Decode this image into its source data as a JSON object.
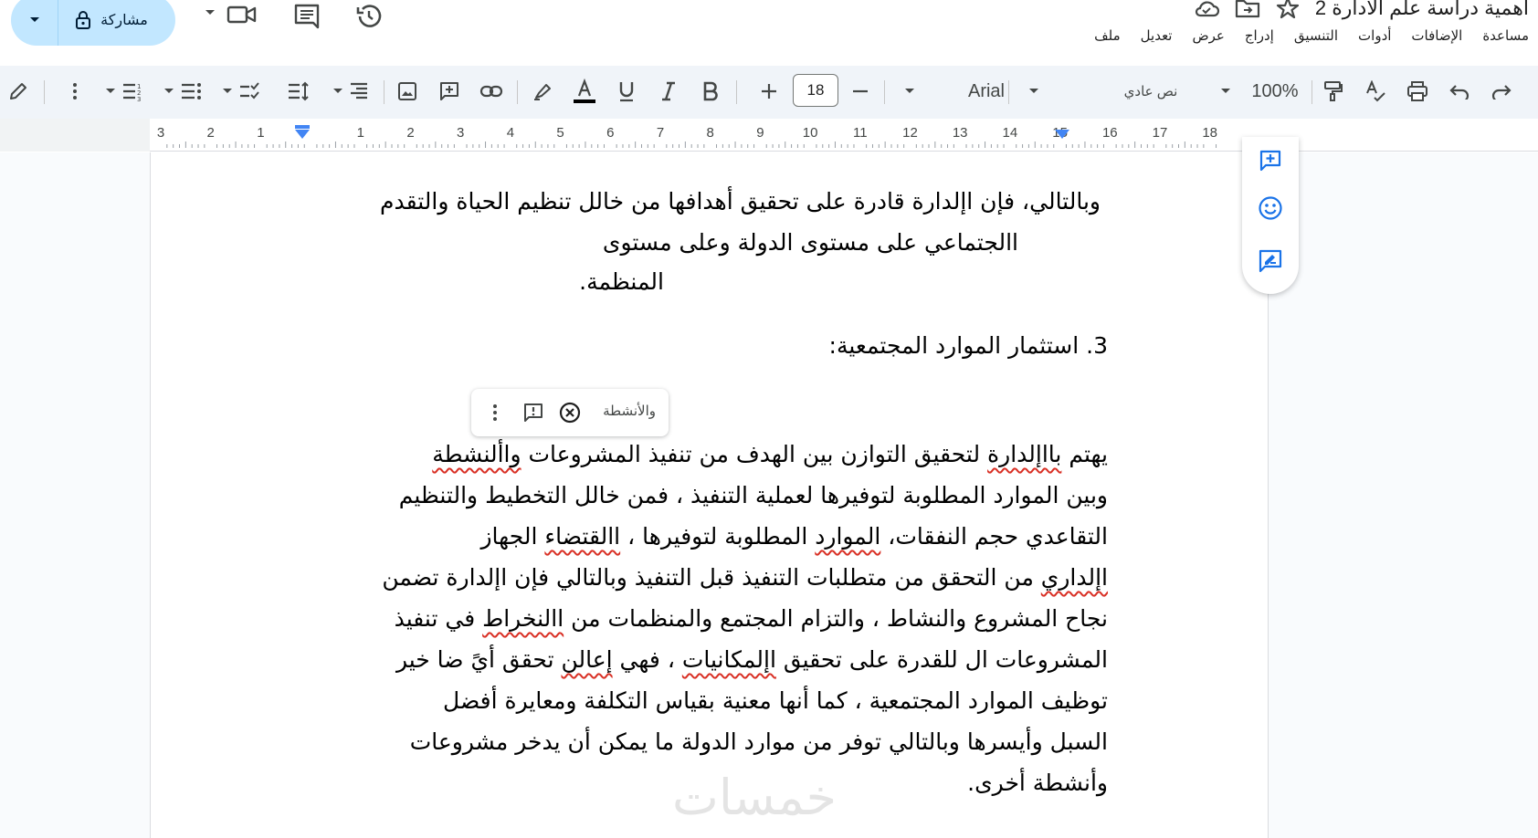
{
  "titlebar": {
    "document_title": "اهمية دراسة علم الادارة 2",
    "share_label": "مشاركة",
    "icons": [
      "lock-icon",
      "meet-video-icon",
      "comments-icon",
      "version-history-icon",
      "cloud-saved-icon",
      "move-to-folder-icon",
      "star-icon"
    ]
  },
  "menu": [
    "ملف",
    "تعديل",
    "عرض",
    "إدراج",
    "التنسيق",
    "أدوات",
    "الإضافات",
    "مساعدة"
  ],
  "toolbar": {
    "font_size": "18",
    "font_name": "Arial",
    "paragraph_style": "نص عادي",
    "zoom": "100%"
  },
  "ruler": {
    "labels": [
      "3",
      "2",
      "1",
      "",
      "1",
      "2",
      "3",
      "4",
      "5",
      "6",
      "7",
      "8",
      "9",
      "10",
      "11",
      "12",
      "13",
      "14",
      "15",
      "16",
      "17",
      "18"
    ]
  },
  "document": {
    "para1": {
      "line1": "وبالتالي، فإن اإلدارة قادرة على تحقيق أهدافها من خالل تنظيم الحياة والتقدم",
      "line2": "االجتماعي على مستوى الدولة وعلى مستوى",
      "line3": "المنظمة."
    },
    "heading": "3. استثمار الموارد المجتمعية:",
    "para2": {
      "line1_a": "يهتم ",
      "line1_b": "بااإلدارة",
      "line1_c": " لتحقيق التوازن بين الهدف من تنفيذ المشروعات ",
      "line1_d": "واألنشطة",
      "line2": "وبين الموارد المطلوبة لتوفيرها لعملية التنفيذ ، فمن خالل التخطيط والتنظيم",
      "line3_a": "التقاعدي حجم النفقات، ",
      "line3_b": "الموارد",
      "line3_c": " المطلوبة لتوفيرها ، ",
      "line3_d": "االقتضاء",
      "line3_e": " الجهاز",
      "line4_a": "",
      "line4_b": "اإلداري",
      "line4_c": " من التحقق من متطلبات التنفيذ قبل التنفيذ وبالتالي فإن اإلدارة تضمن",
      "line5_a": "نجاح المشروع والنشاط ، والتزام المجتمع والمنظمات من ",
      "line5_b": "االنخراط",
      "line5_c": " في تنفيذ",
      "line6_a": "المشروعات ال للقدرة على تحقيق ",
      "line6_b": "اإلمكانيات",
      "line6_c": " ، فهي ",
      "line6_d": "إعالن",
      "line6_e": " تحقق أيً ضا خير",
      "line7": "توظيف الموارد المجتمعية ، كما أنها معنية بقياس التكلفة ومعايرة أفضل",
      "line8": "السبل وأيسرها وبالتالي توفر من موارد الدولة ما يمكن أن يدخر مشروعات",
      "line9": "وأنشطة أخرى."
    }
  },
  "spell_suggestion": {
    "word": "والأنشطة"
  },
  "watermark": "خمسات"
}
